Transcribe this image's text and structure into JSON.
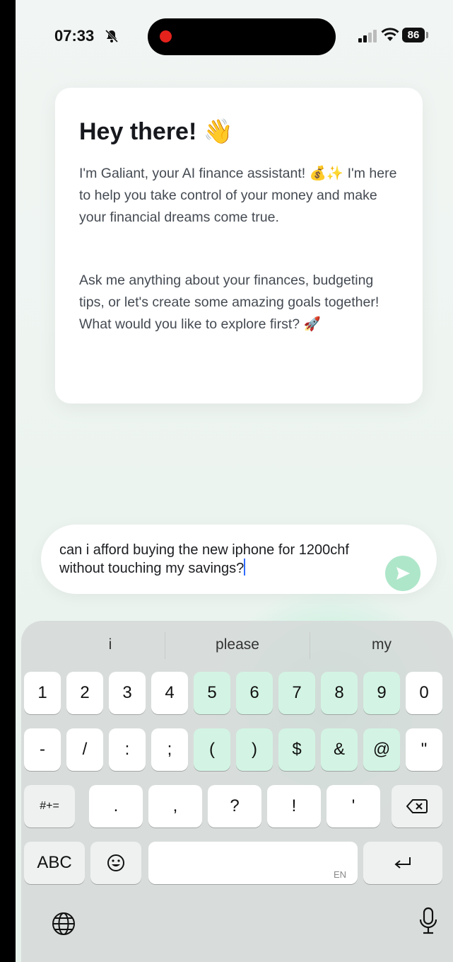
{
  "status": {
    "time": "07:33",
    "battery": "86"
  },
  "card": {
    "title": "Hey there! 👋",
    "paragraph1": "I'm Galiant, your AI finance assistant! 💰✨ I'm here to help you take control of your money and make your financial dreams come true.",
    "paragraph2": "Ask me anything about your finances, budgeting tips, or let's create some amazing goals together! What would you like to explore first? 🚀"
  },
  "input": {
    "value": "can i afford buying the new iphone for 1200chf without touching my savings?",
    "send_icon": "send-arrow-icon"
  },
  "keyboard": {
    "suggestions": [
      "i",
      "please",
      "my"
    ],
    "row1": [
      "1",
      "2",
      "3",
      "4",
      "5",
      "6",
      "7",
      "8",
      "9",
      "0"
    ],
    "row2": [
      "-",
      "/",
      ":",
      ";",
      "(",
      ")",
      "$",
      "&",
      "@",
      "\""
    ],
    "row3": {
      "mode_key": "#+=",
      "keys": [
        ".",
        ",",
        "?",
        "!",
        "'"
      ]
    },
    "row4": {
      "abc_key": "ABC",
      "space_lang": "EN"
    }
  }
}
